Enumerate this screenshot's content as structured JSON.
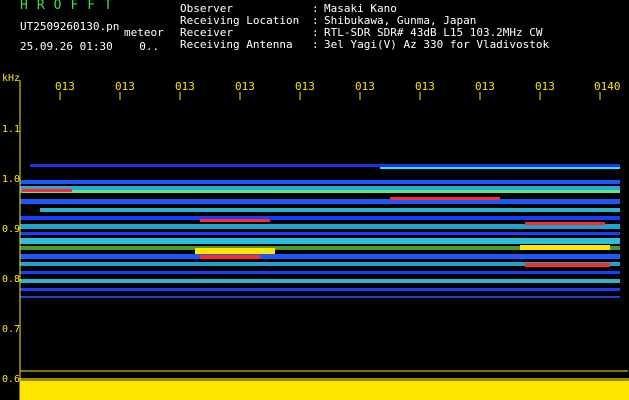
{
  "header": {
    "title": "HROFFT",
    "filename": "UT2509260130.pn",
    "tag": "meteor",
    "datetime": "25.09.26 01:30",
    "extra": "0.."
  },
  "station": [
    {
      "label": "Observer",
      "value": "Masaki Kano"
    },
    {
      "label": "Receiving Location",
      "value": "Shibukawa, Gunma, Japan"
    },
    {
      "label": "Receiver",
      "value": "RTL-SDR SDR# 43dB L15 103.2MHz CW"
    },
    {
      "label": "Receiving Antenna",
      "value": "3el Yagi(V) Az 330 for Vladivostok"
    }
  ],
  "axis": {
    "unit": "kHz",
    "freq_ticks": [
      "1.1",
      "1.0",
      "0.9",
      "0.8",
      "0.7",
      "0.6"
    ],
    "time_ticks": [
      "013",
      "013",
      "013",
      "013",
      "013",
      "013",
      "013",
      "013",
      "013",
      "0140"
    ]
  },
  "colors": {
    "axis": "#ffe600",
    "background": "#000000",
    "title": "#3ee03e",
    "signal_low": "#1a3cff",
    "signal_high": "#ff2a2a"
  }
}
